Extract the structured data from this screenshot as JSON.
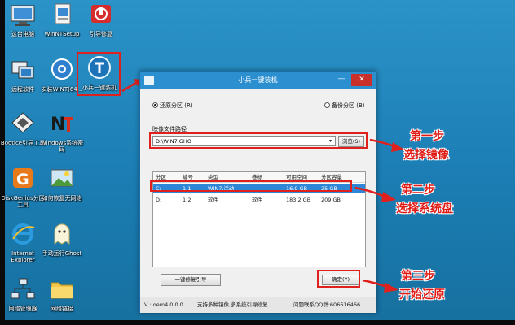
{
  "desktop": {
    "icons": [
      {
        "id": "computer",
        "label": "这台电脑"
      },
      {
        "id": "wintsetup",
        "label": "WinNTSetup"
      },
      {
        "id": "bootfix",
        "label": "引导修复"
      },
      {
        "id": "network",
        "label": "远程软件"
      },
      {
        "id": "installwin",
        "label": "安装WINT(64..."
      },
      {
        "id": "onekey",
        "label": "小兵一键装机"
      },
      {
        "id": "bootice",
        "label": "Bootice引导工具"
      },
      {
        "id": "ntpwd",
        "label": "Windows系统密码"
      },
      {
        "id": "diskgenius",
        "label": "DiskGenius分区工具"
      },
      {
        "id": "ghostbackup",
        "label": "如何恢复无网络"
      },
      {
        "id": "ie",
        "label": "Internet Explorer"
      },
      {
        "id": "ghost",
        "label": "手动运行Ghost"
      },
      {
        "id": "netmgr",
        "label": "网络管理器"
      },
      {
        "id": "netlink",
        "label": "网络链接"
      }
    ]
  },
  "window": {
    "title": "小兵一键装机",
    "min_label": "—",
    "close_label": "✕",
    "radio_restore": "还原分区 (R)",
    "radio_backup": "备份分区 (B)",
    "image_path_label": "映像文件路径",
    "image_path_value": "D:\\WIN7.GHO",
    "browse_label": "浏览(S)",
    "table": {
      "headers": [
        "分区",
        "编号",
        "类型",
        "卷标",
        "可用空间",
        "分区容量"
      ],
      "rows": [
        [
          "C:",
          "1:1",
          "WIN7,活动",
          "",
          "16.9 GB",
          "25 GB"
        ],
        [
          "D:",
          "1:2",
          "软件",
          "软件",
          "183.2 GB",
          "209 GB"
        ]
      ]
    },
    "repair_button": "一键修复引导",
    "ok_button": "确定(Y)",
    "status": {
      "version": "V : oem4.0.0.0",
      "support": "支持多种镜像,多系统引导修复",
      "contact": "问题联系QQ群:606616466"
    }
  },
  "annotations": {
    "step1_title": "第一步",
    "step1_desc": "选择镜像",
    "step2_title": "第二步",
    "step2_desc": "选择系统盘",
    "step3_title": "第三步",
    "step3_desc": "开始还原",
    "color": "#e0201c"
  }
}
